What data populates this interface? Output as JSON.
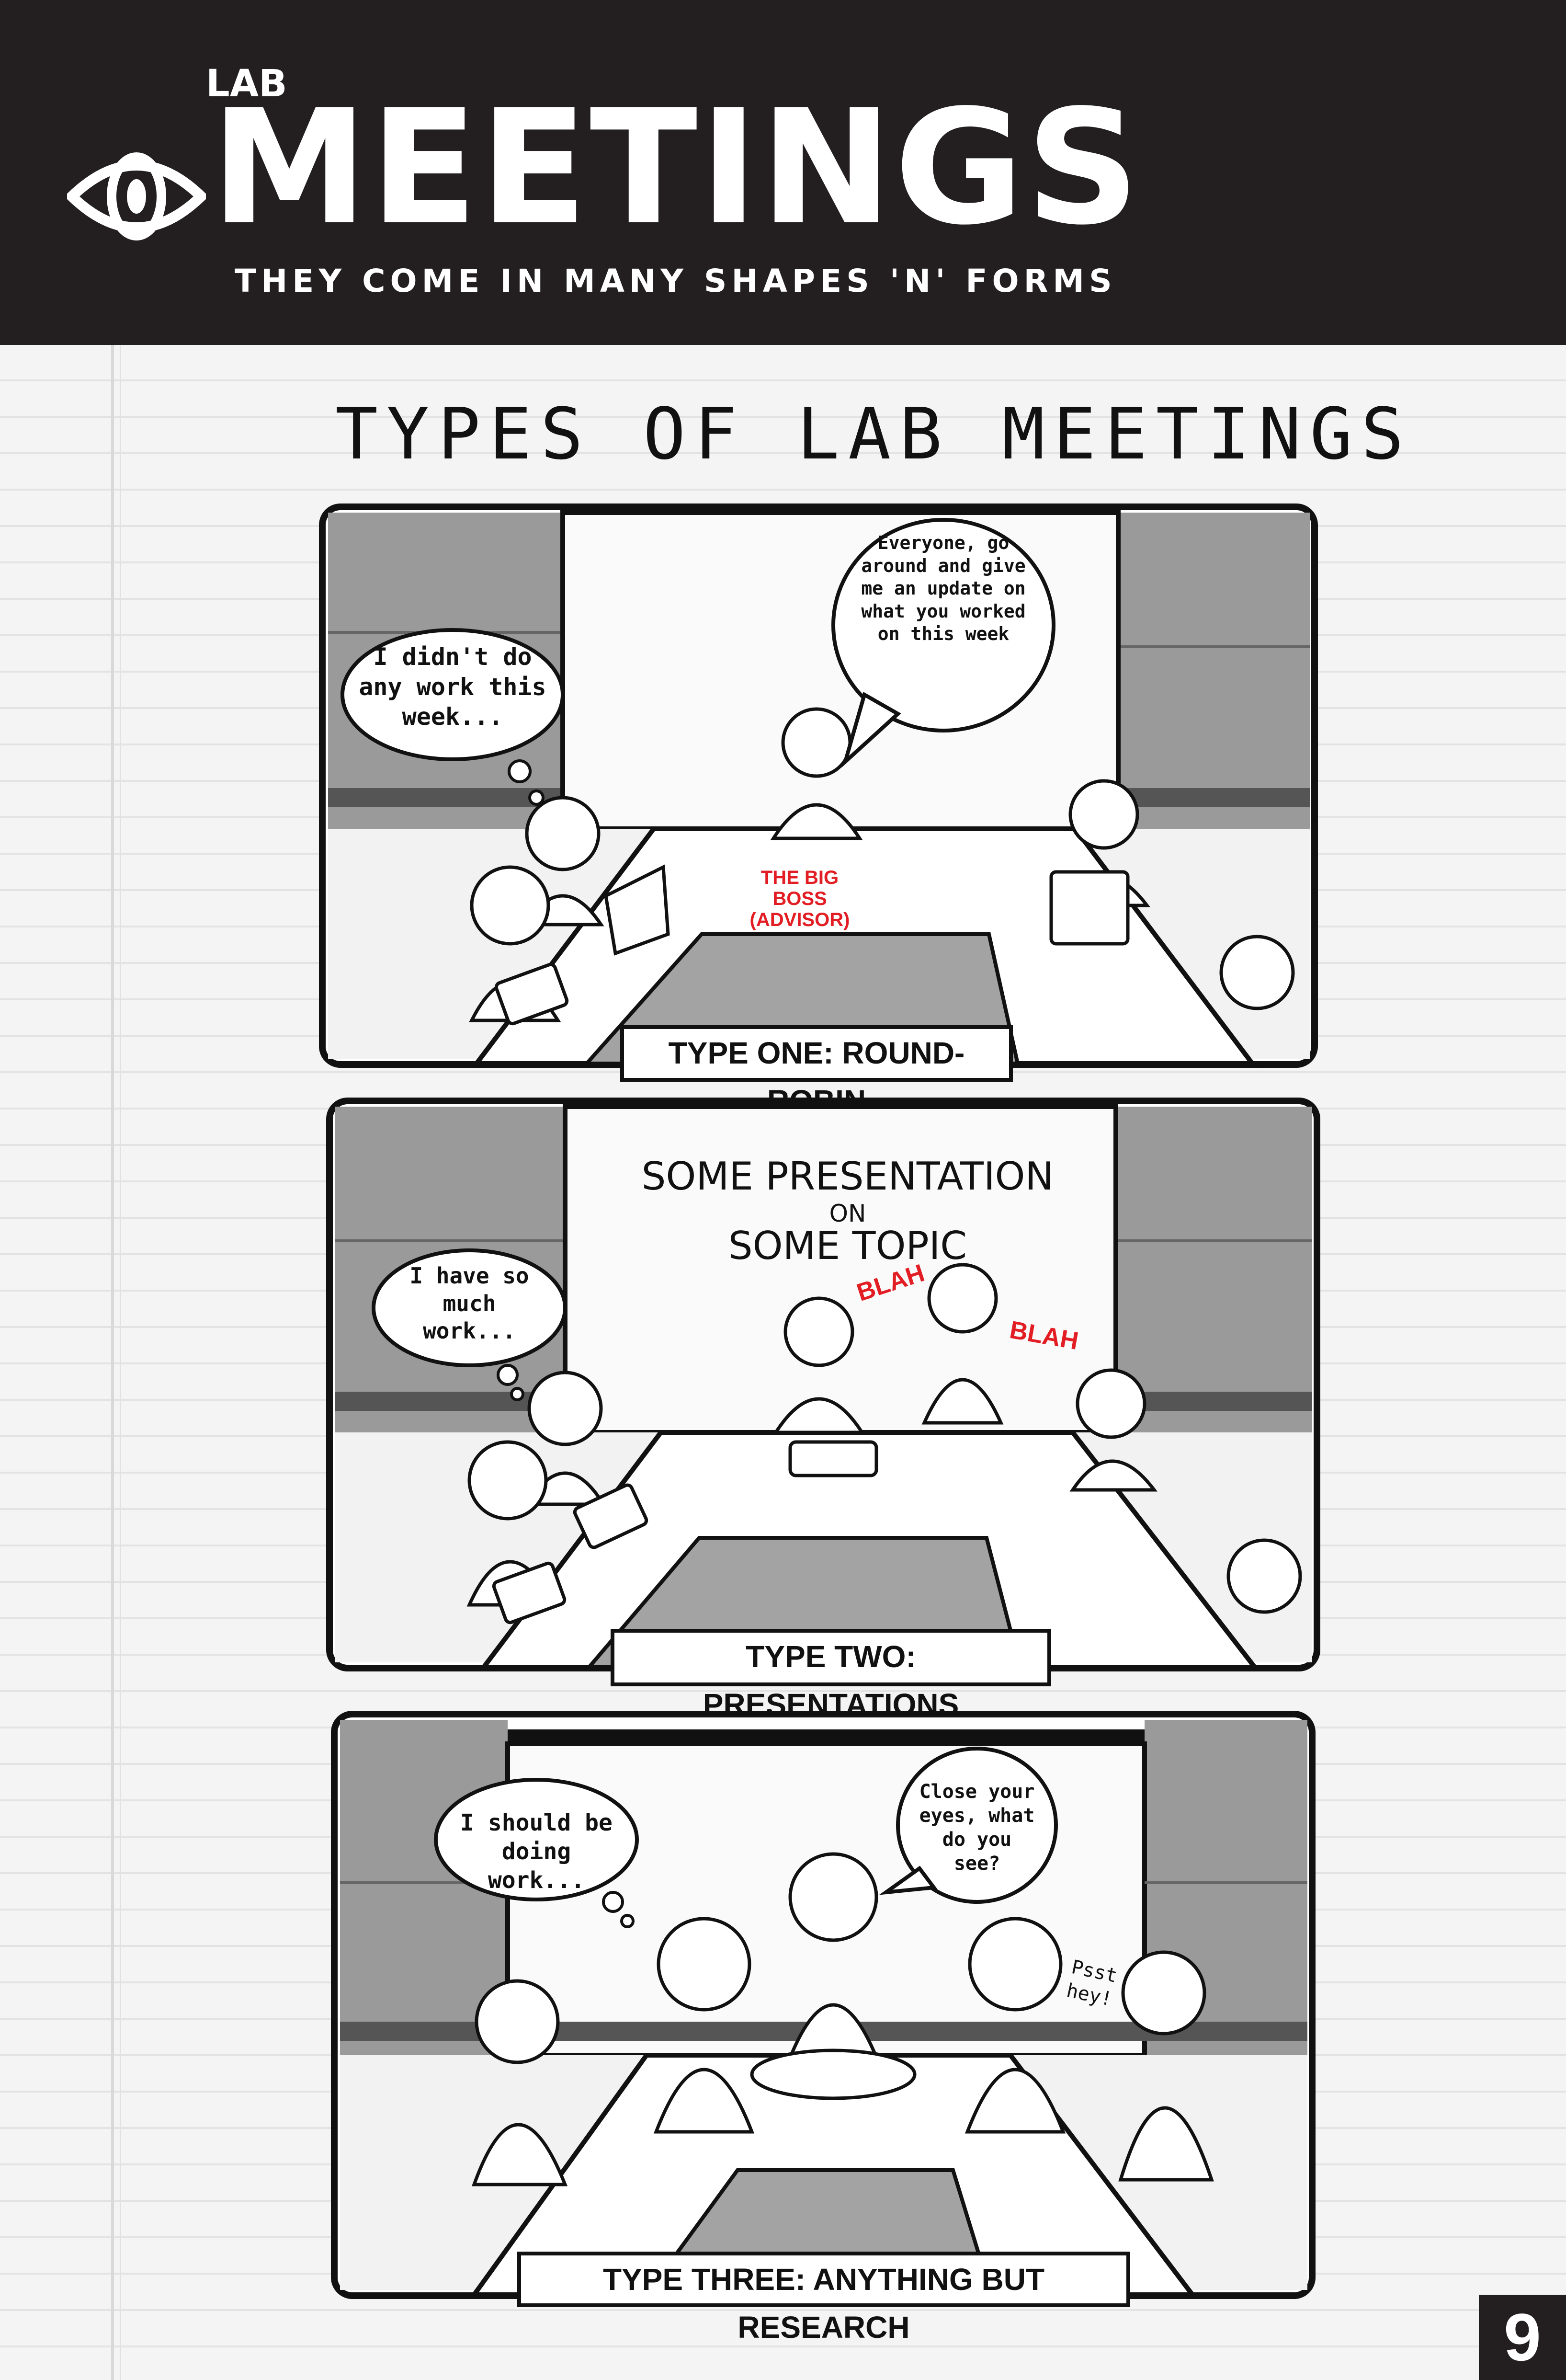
{
  "header": {
    "logo_prefix": "LAB",
    "logo_title": "MEETINGS",
    "subtitle": "THEY COME IN MANY SHAPES 'N' FORMS"
  },
  "page_heading": "TYPES OF LAB MEETINGS",
  "panels": [
    {
      "caption": "TYPE ONE: ROUND-ROBIN",
      "thought": "I didn't do any work this week...",
      "speech": "Everyone, go around and give me an update on what you worked on this week",
      "label": "THE BIG BOSS (ADVISOR)"
    },
    {
      "caption": "TYPE TWO: PRESENTATIONS",
      "thought": "I have so much work...",
      "screen_line1": "SOME PRESENTATION",
      "screen_line2": "ON",
      "screen_line3": "SOME TOPIC",
      "blah1": "BLAH",
      "blah2": "BLAH"
    },
    {
      "caption": "TYPE THREE: ANYTHING BUT RESEARCH",
      "thought": "I should be doing work...",
      "speech": "Close your eyes, what do you see?",
      "whisper": "Psst hey!"
    }
  ],
  "page_number": "9",
  "colors": {
    "header_bg": "#231f20",
    "panel_grey": "#9a9a9a",
    "highlight_red": "#e21d24"
  }
}
